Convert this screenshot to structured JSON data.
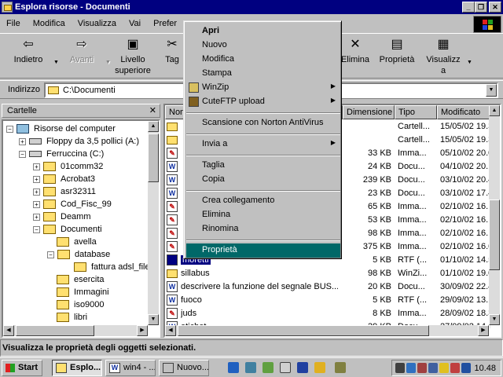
{
  "window": {
    "title": "Esplora risorse - Documenti"
  },
  "menu": [
    "File",
    "Modifica",
    "Visualizza",
    "Vai",
    "Prefer"
  ],
  "toolbar": {
    "back": "Indietro",
    "forward": "Avanti",
    "up_line1": "Livello",
    "up_line2": "superiore",
    "cut_partial": "Tag",
    "delete": "Elimina",
    "properties": "Proprietà",
    "view_line1": "Visualizz",
    "view_line2": "a"
  },
  "address": {
    "label": "Indirizzo",
    "value": "C:\\Documenti"
  },
  "tree": {
    "header": "Cartelle",
    "nodes": [
      "Risorse del computer",
      "Floppy da 3,5 pollici (A:)",
      "Ferruccina (C:)",
      "01comm32",
      "Acrobat3",
      "asr32311",
      "Cod_Fisc_99",
      "Deamm",
      "Documenti",
      "avella",
      "database",
      "fattura adsl_file",
      "esercita",
      "Immagini",
      "iso9000",
      "libri"
    ]
  },
  "list": {
    "columns": [
      "Nome",
      "Dimensione",
      "Tipo",
      "Modificato"
    ],
    "rows": [
      {
        "name": "",
        "size": "",
        "type": "Cartell...",
        "mod": "15/05/02 19.3"
      },
      {
        "name": "",
        "size": "",
        "type": "Cartell...",
        "mod": "15/05/02 19.3"
      },
      {
        "name": "",
        "size": "33 KB",
        "type": "Imma...",
        "mod": "05/10/02 20.0"
      },
      {
        "name": "",
        "size": "24 KB",
        "type": "Docu...",
        "mod": "04/10/02 20.1"
      },
      {
        "name": "",
        "size": "239 KB",
        "type": "Docu...",
        "mod": "03/10/02 20.4"
      },
      {
        "name": "",
        "size": "23 KB",
        "type": "Docu...",
        "mod": "03/10/02 17.4"
      },
      {
        "name": "",
        "size": "65 KB",
        "type": "Imma...",
        "mod": "02/10/02 16.1"
      },
      {
        "name": "",
        "size": "53 KB",
        "type": "Imma...",
        "mod": "02/10/02 16.1"
      },
      {
        "name": "",
        "size": "98 KB",
        "type": "Imma...",
        "mod": "02/10/02 16.1"
      },
      {
        "name": "",
        "size": "375 KB",
        "type": "Imma...",
        "mod": "02/10/02 16.0"
      },
      {
        "name": "moretti",
        "size": "5 KB",
        "type": "RTF (...",
        "mod": "01/10/02 14.5"
      },
      {
        "name": "sillabus",
        "size": "98 KB",
        "type": "WinZi...",
        "mod": "01/10/02 19.0"
      },
      {
        "name": "descrivere la funzione del segnale BUS...",
        "size": "20 KB",
        "type": "Docu...",
        "mod": "30/09/02 22.4"
      },
      {
        "name": "fuoco",
        "size": "5 KB",
        "type": "RTF (...",
        "mod": "29/09/02 13.1"
      },
      {
        "name": "juds",
        "size": "8 KB",
        "type": "Imma...",
        "mod": "28/09/02 18.3"
      },
      {
        "name": "etichet",
        "size": "39 KB",
        "type": "Docu...",
        "mod": "27/09/02 14.1"
      }
    ]
  },
  "context_menu": {
    "items": [
      "Apri",
      "Nuovo",
      "Modifica",
      "Stampa",
      "WinZip",
      "CuteFTP upload",
      "Scansione con Norton AntiVirus",
      "Invia a",
      "Taglia",
      "Copia",
      "Crea collegamento",
      "Elimina",
      "Rinomina",
      "Proprietà"
    ]
  },
  "status": "Visualizza le proprietà degli oggetti selezionati.",
  "taskbar": {
    "start": "Start",
    "tasks": [
      "Esplo...",
      "win4 - ...",
      "Nuovo..."
    ],
    "clock": "10.48"
  },
  "colors": {
    "titlebar": "#000080",
    "menu_highlight": "#006868",
    "face": "#c0c0c0",
    "desktop": "#008080"
  }
}
